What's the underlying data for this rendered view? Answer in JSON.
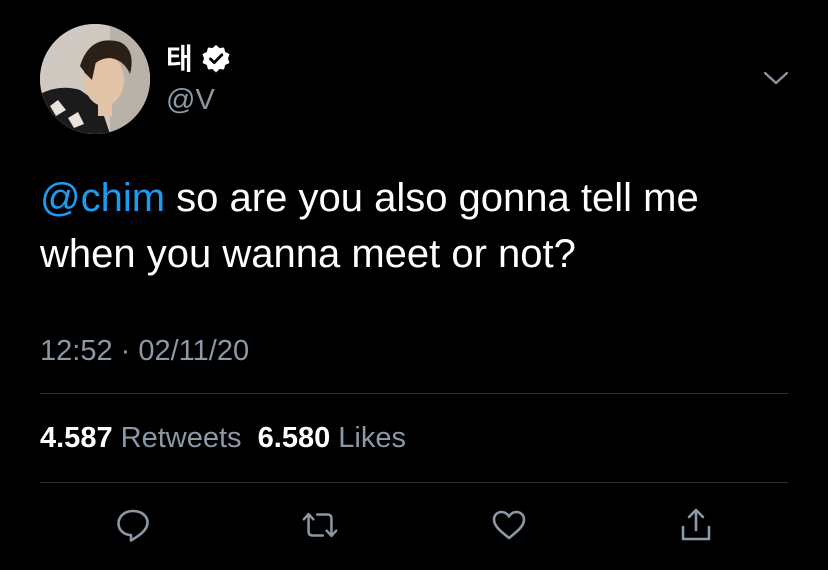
{
  "author": {
    "display_name": "태",
    "handle": "@V",
    "verified": true
  },
  "tweet": {
    "mention": "@chim",
    "text": " so are you also gonna tell me when you wanna meet or not?",
    "time": "12:52",
    "separator": " · ",
    "date": "02/11/20"
  },
  "stats": {
    "retweets_count": "4.587",
    "retweets_label": "Retweets",
    "likes_count": "6.580",
    "likes_label": "Likes"
  },
  "actions": [
    "reply-icon",
    "retweet-icon",
    "like-icon",
    "share-icon"
  ],
  "colors": {
    "background": "#000000",
    "text": "#ffffff",
    "secondary": "#8b98a5",
    "accent": "#1d9bf0",
    "divider": "#2f3336"
  }
}
